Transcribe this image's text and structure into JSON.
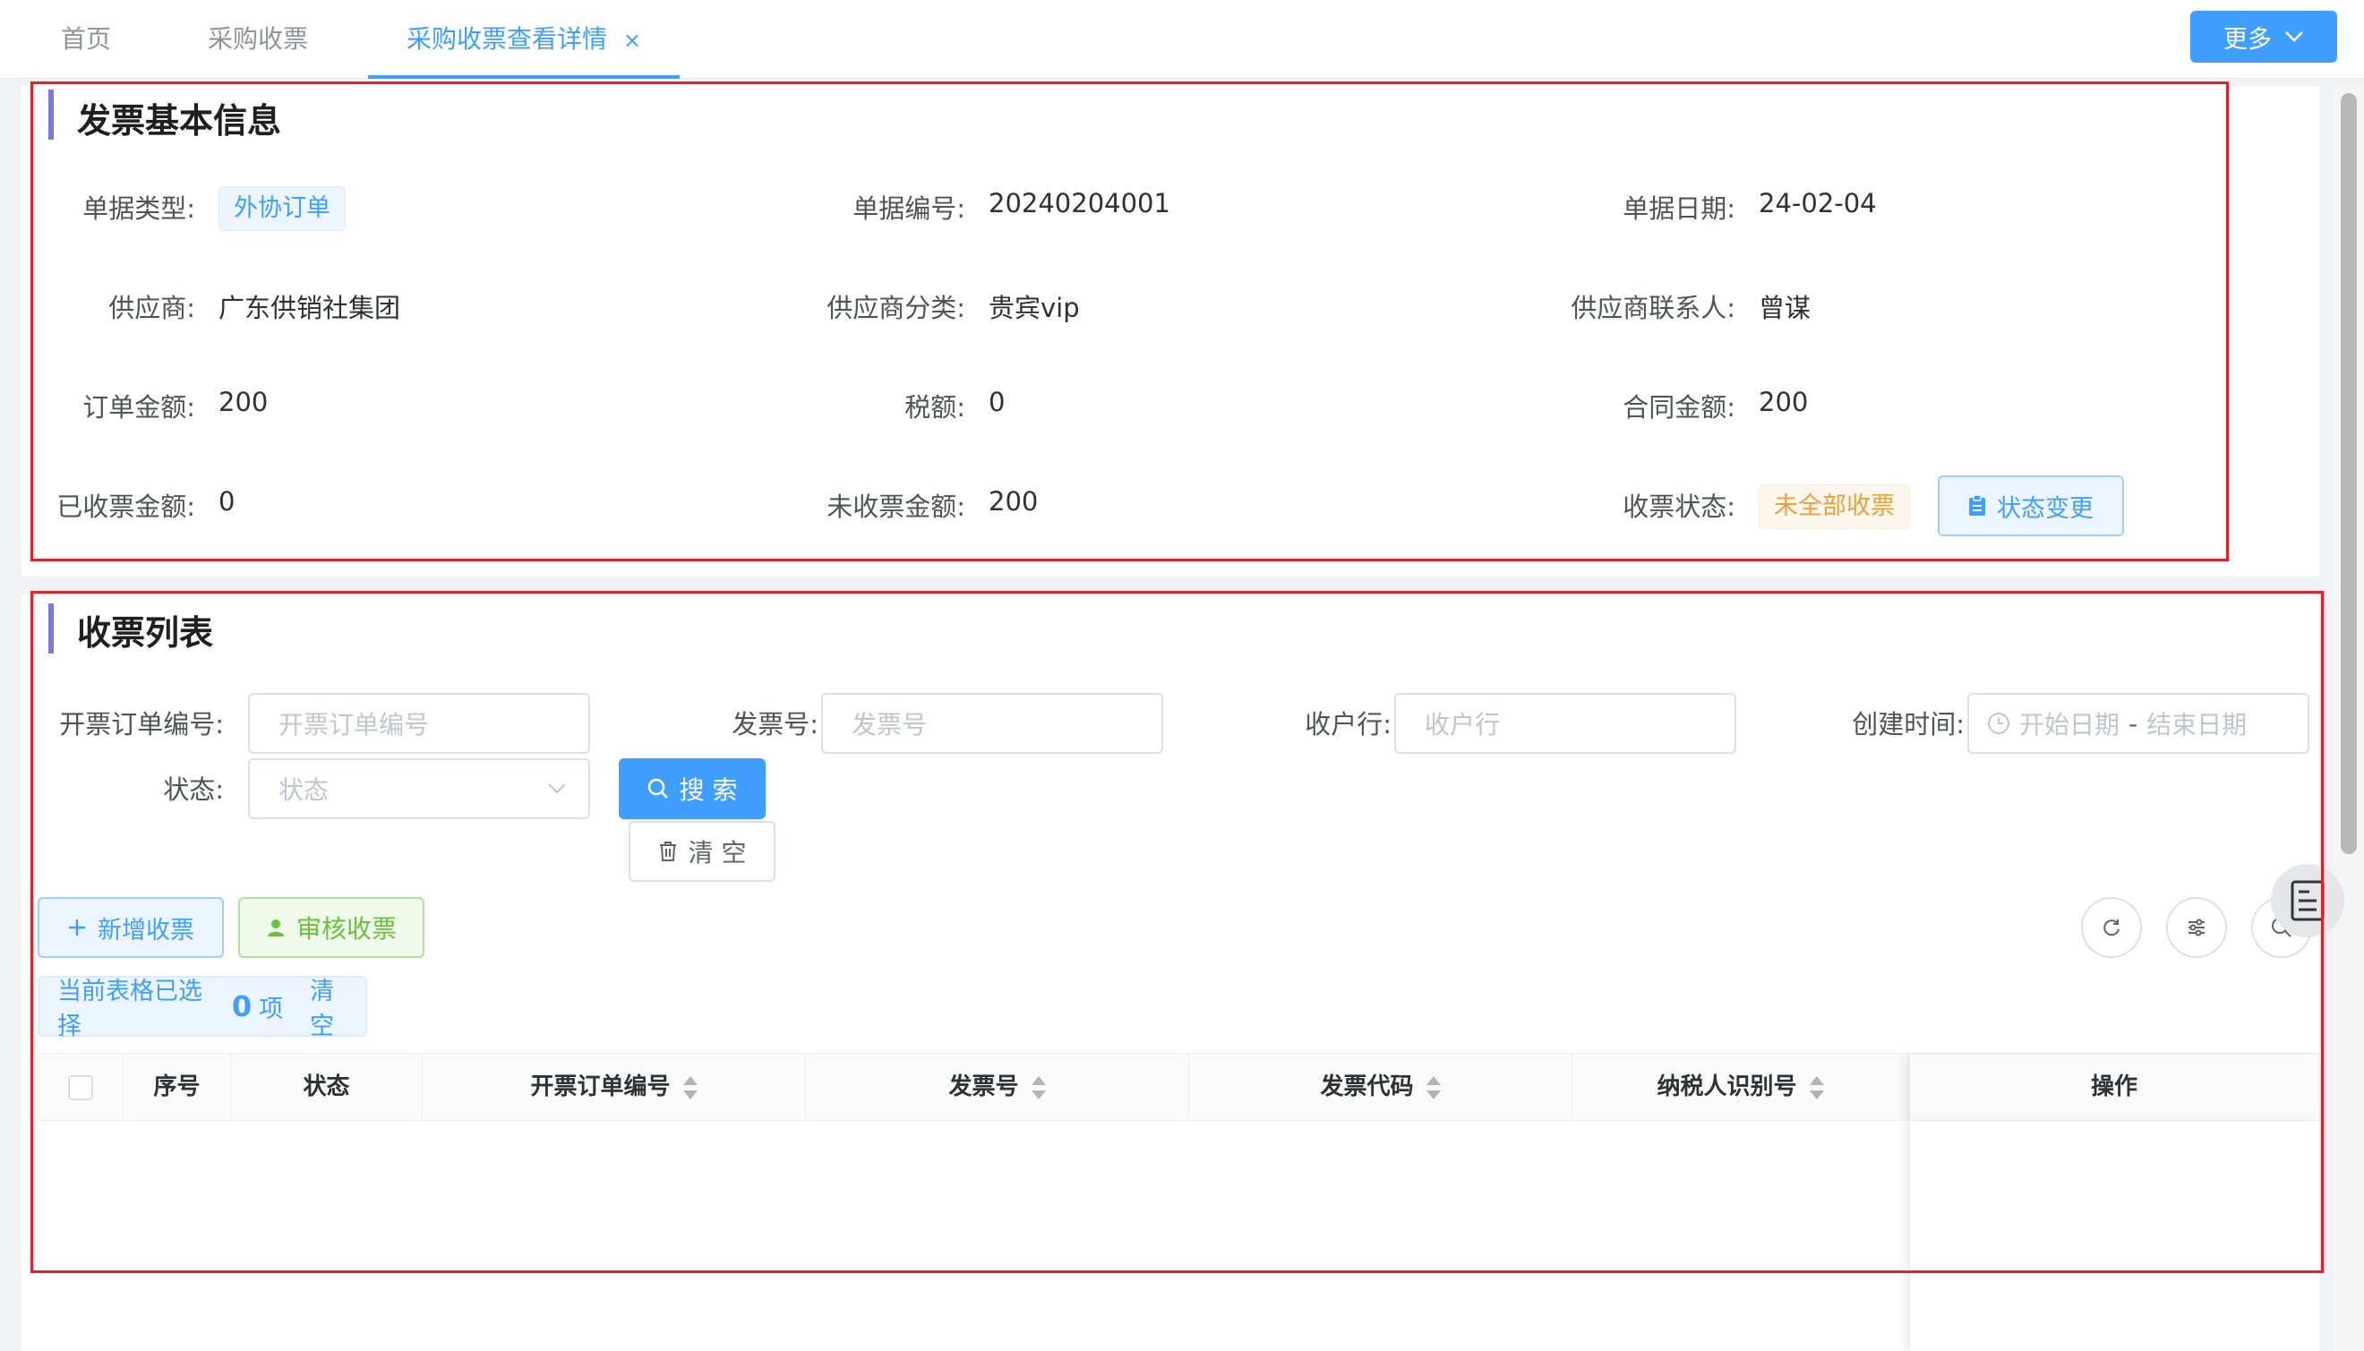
{
  "tabs": [
    {
      "label": "首页"
    },
    {
      "label": "采购收票"
    },
    {
      "label": "采购收票查看详情",
      "close": "×"
    }
  ],
  "more_button": {
    "label": "更多"
  },
  "invoice_info": {
    "title": "发票基本信息",
    "fields": {
      "doc_type": {
        "label": "单据类型:",
        "value": "外协订单"
      },
      "doc_no": {
        "label": "单据编号:",
        "value": "20240204001"
      },
      "doc_date": {
        "label": "单据日期:",
        "value": "24-02-04"
      },
      "supplier": {
        "label": "供应商:",
        "value": "广东供销社集团"
      },
      "supplier_category": {
        "label": "供应商分类:",
        "value": "贵宾vip"
      },
      "supplier_contact": {
        "label": "供应商联系人:",
        "value": "曾谋"
      },
      "order_amount": {
        "label": "订单金额:",
        "value": "200"
      },
      "tax": {
        "label": "税额:",
        "value": "0"
      },
      "contract_amount": {
        "label": "合同金额:",
        "value": "200"
      },
      "received_amount": {
        "label": "已收票金额:",
        "value": "0"
      },
      "unreceived_amount": {
        "label": "未收票金额:",
        "value": "200"
      },
      "receipt_status": {
        "label": "收票状态:",
        "value": "未全部收票"
      }
    },
    "status_change_button": "状态变更",
    "colors": {
      "blue_tag": "#409eff",
      "orange_tag": "#e6a23c"
    }
  },
  "receipt_list": {
    "title": "收票列表",
    "filters": {
      "order_no": {
        "label": "开票订单编号:",
        "placeholder": "开票订单编号"
      },
      "invoice_no": {
        "label": "发票号:",
        "placeholder": "发票号"
      },
      "bank": {
        "label": "收户行:",
        "placeholder": "收户行"
      },
      "created_time": {
        "label": "创建时间:",
        "start_placeholder": "开始日期",
        "separator": "-",
        "end_placeholder": "结束日期"
      },
      "status": {
        "label": "状态:",
        "placeholder": "状态"
      }
    },
    "search_button": "搜 索",
    "clear_button": "清 空",
    "add_button": "新增收票",
    "audit_button": "审核收票",
    "selection": {
      "prefix": "当前表格已选择",
      "count": "0",
      "suffix": "项",
      "clear": "清 空"
    },
    "table": {
      "columns": [
        "序号",
        "状态",
        "开票订单编号",
        "发票号",
        "发票代码",
        "纳税人识别号",
        "操作"
      ]
    },
    "colors": {
      "primary": "#409eff",
      "success": "#67c23a"
    }
  }
}
